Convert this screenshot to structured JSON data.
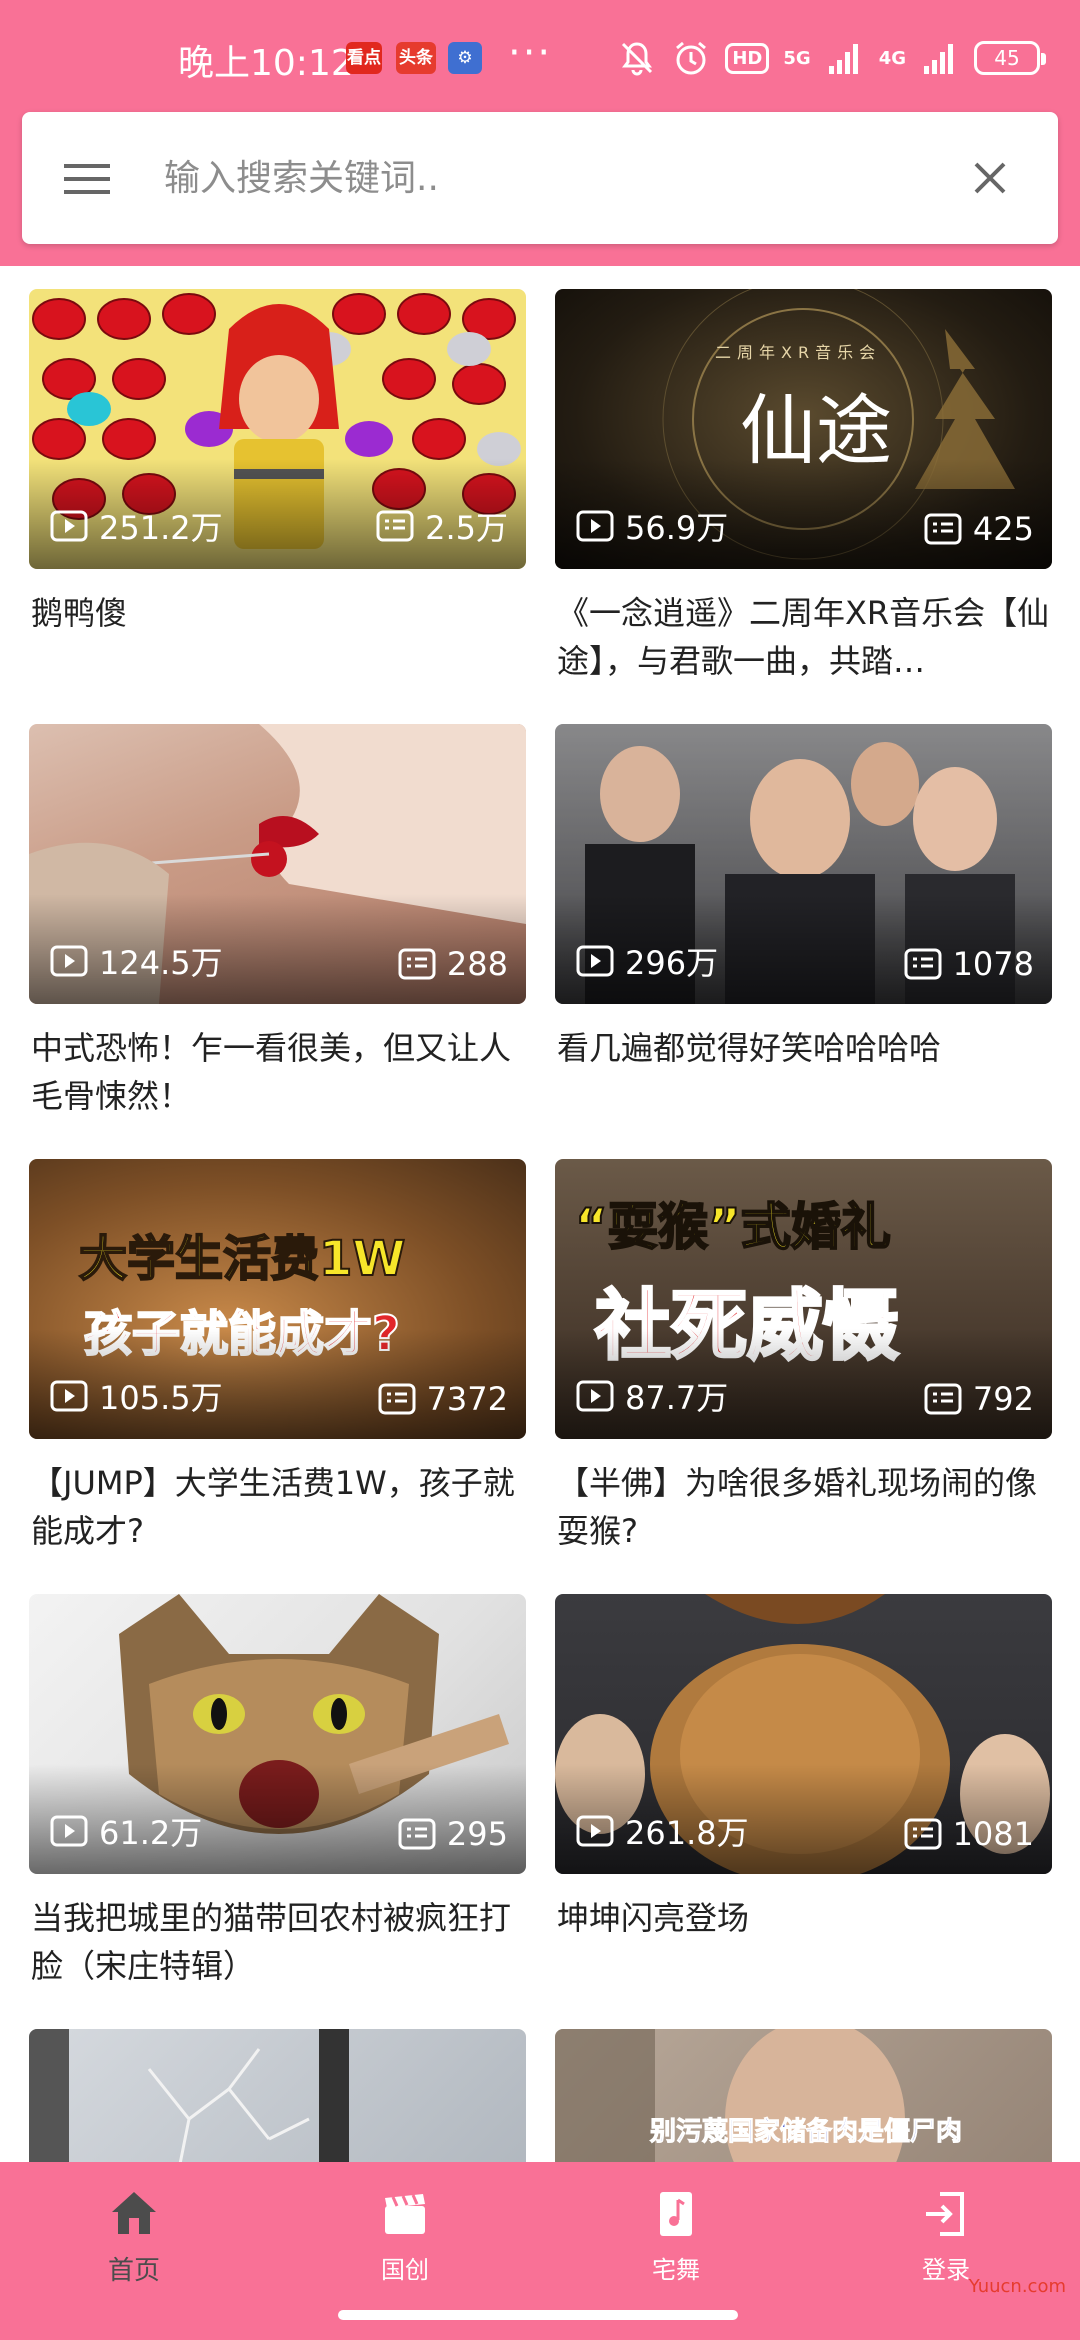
{
  "status_bar": {
    "time": "晚上10:12",
    "apps": [
      "看点",
      "头条",
      "⚙"
    ],
    "more": "···",
    "hd": "HD",
    "net1": "5G",
    "net2": "4G",
    "battery": "45"
  },
  "search": {
    "placeholder": "输入搜索关键词.."
  },
  "videos": [
    {
      "views": "251.2万",
      "danmaku": "2.5万",
      "title": "鹅鸭傻"
    },
    {
      "views": "56.9万",
      "danmaku": "425",
      "title": "《一念逍遥》二周年XR音乐会【仙途】，与君歌一曲，共踏…"
    },
    {
      "views": "124.5万",
      "danmaku": "288",
      "title": "中式恐怖！乍一看很美，但又让人毛骨悚然！"
    },
    {
      "views": "296万",
      "danmaku": "1078",
      "title": "看几遍都觉得好笑哈哈哈哈"
    },
    {
      "views": "105.5万",
      "danmaku": "7372",
      "title": "【JUMP】大学生活费1W，孩子就能成才?"
    },
    {
      "views": "87.7万",
      "danmaku": "792",
      "title": "【半佛】为啥很多婚礼现场闹的像耍猴?"
    },
    {
      "views": "61.2万",
      "danmaku": "295",
      "title": "当我把城里的猫带回农村被疯狂打脸（宋庄特辑）"
    },
    {
      "views": "261.8万",
      "danmaku": "1081",
      "title": "坤坤闪亮登场"
    },
    {
      "views": "",
      "danmaku": "",
      "title": ""
    },
    {
      "views": "",
      "danmaku": "",
      "title": ""
    }
  ],
  "thumb_text": {
    "v2_top": "二周年XR音乐会",
    "v2_main": "仙途",
    "v5_line1": "大学生活费1W",
    "v5_line2": "孩子就能成才?",
    "v6_line1": "“耍猴”式婚礼",
    "v6_line2": "社死威慑",
    "v10_caption": "别污蔑国家储备肉是僵尸肉"
  },
  "nav": {
    "items": [
      {
        "label": "首页",
        "icon": "home-icon"
      },
      {
        "label": "国创",
        "icon": "clapperboard-icon"
      },
      {
        "label": "宅舞",
        "icon": "music-note-icon"
      },
      {
        "label": "登录",
        "icon": "login-icon"
      }
    ]
  },
  "watermark": "Yuucn.com",
  "colors": {
    "brand_pink": "#f97196",
    "active_nav_text": "#4c4c4c",
    "title_text": "#222222"
  }
}
